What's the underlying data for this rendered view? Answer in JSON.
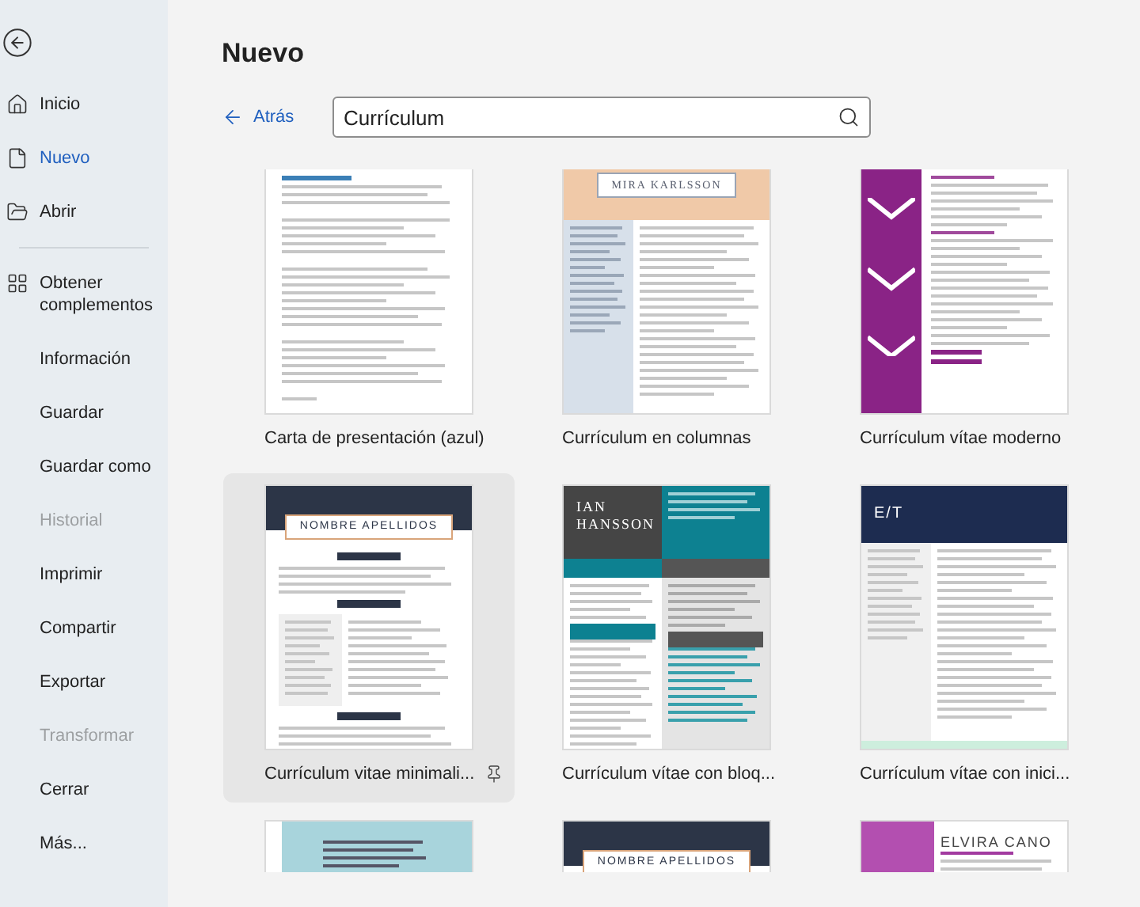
{
  "sidebar": {
    "primary": [
      {
        "label": "Inicio",
        "kind": "home",
        "selected": false,
        "disabled": false
      },
      {
        "label": "Nuevo",
        "kind": "new",
        "selected": true,
        "disabled": false
      },
      {
        "label": "Abrir",
        "kind": "open",
        "selected": false,
        "disabled": false
      }
    ],
    "secondary": [
      {
        "label": "Obtener complementos",
        "kind": "addins",
        "selected": false,
        "disabled": false
      },
      {
        "label": "Información",
        "kind": "plain",
        "selected": false,
        "disabled": false
      },
      {
        "label": "Guardar",
        "kind": "plain",
        "selected": false,
        "disabled": false
      },
      {
        "label": "Guardar como",
        "kind": "plain",
        "selected": false,
        "disabled": false
      },
      {
        "label": "Historial",
        "kind": "plain",
        "selected": false,
        "disabled": true
      },
      {
        "label": "Imprimir",
        "kind": "plain",
        "selected": false,
        "disabled": false
      },
      {
        "label": "Compartir",
        "kind": "plain",
        "selected": false,
        "disabled": false
      },
      {
        "label": "Exportar",
        "kind": "plain",
        "selected": false,
        "disabled": false
      },
      {
        "label": "Transformar",
        "kind": "plain",
        "selected": false,
        "disabled": true
      },
      {
        "label": "Cerrar",
        "kind": "plain",
        "selected": false,
        "disabled": false
      },
      {
        "label": "Más...",
        "kind": "plain",
        "selected": false,
        "disabled": false
      }
    ]
  },
  "main": {
    "title": "Nuevo",
    "back_link": "Atrás",
    "search": {
      "value": "Currículum"
    },
    "templates": [
      {
        "name": "Carta de presentación (azul)",
        "kind": "letter",
        "selected": false
      },
      {
        "name": "Currículum en columnas",
        "kind": "columns",
        "headline": "MIRA KARLSSON",
        "selected": false
      },
      {
        "name": "Currículum vítae moderno",
        "kind": "purple",
        "selected": false
      },
      {
        "name": "Currículum vitae minimali...",
        "kind": "minimal",
        "headline": "NOMBRE APELLIDOS",
        "selected": true
      },
      {
        "name": "Currículum vítae con bloq...",
        "kind": "blocks",
        "headline": "IAN HANSSON",
        "selected": false
      },
      {
        "name": "Currículum vítae con inici...",
        "kind": "initials",
        "headline": "E/T",
        "selected": false
      },
      {
        "kind": "banner",
        "selected": false
      },
      {
        "kind": "minimal",
        "headline": "NOMBRE APELLIDOS",
        "selected": false
      },
      {
        "kind": "photo",
        "headline": "ELVIRA CANO",
        "selected": false
      }
    ]
  }
}
